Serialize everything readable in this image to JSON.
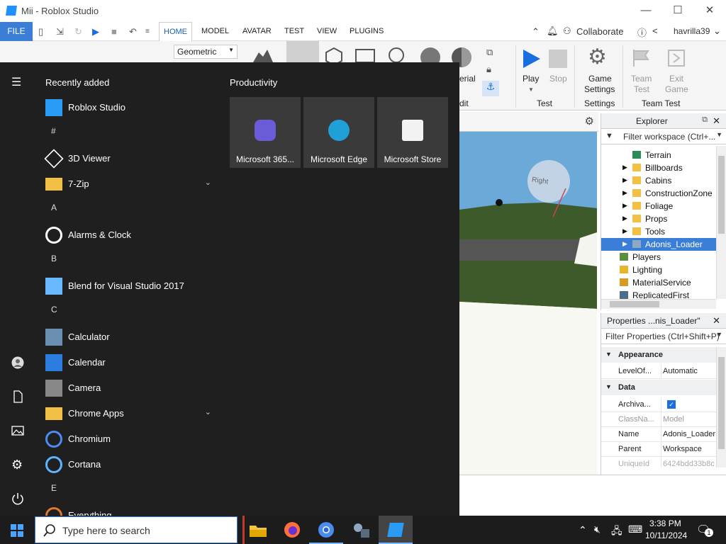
{
  "window": {
    "title": "Mii - Roblox Studio",
    "minimize": "—",
    "maximize": "☐",
    "close": "✕"
  },
  "menubar": {
    "file": "FILE",
    "tabs": [
      "HOME",
      "MODEL",
      "AVATAR",
      "TEST",
      "VIEW",
      "PLUGINS"
    ],
    "collaborate": "Collaborate",
    "username": "havrilla39"
  },
  "ribbon": {
    "dropdown_value": "Geometric",
    "partial_label_1": "erial",
    "partial_label_2": "dit",
    "play": "Play",
    "stop": "Stop",
    "test_group": "Test",
    "game_settings_1": "Game",
    "game_settings_2": "Settings",
    "settings_group": "Settings",
    "team_test_1": "Team",
    "team_test_2": "Test",
    "exit_game_1": "Exit",
    "exit_game_2": "Game",
    "team_test_group": "Team Test"
  },
  "explorer": {
    "title": "Explorer",
    "filter_placeholder": "Filter workspace (Ctrl+...",
    "items": [
      {
        "label": "Terrain",
        "icon": "terrain-icon",
        "indent": 2,
        "arrow": false
      },
      {
        "label": "Billboards",
        "icon": "folder-icon",
        "indent": 2,
        "arrow": true
      },
      {
        "label": "Cabins",
        "icon": "folder-icon",
        "indent": 2,
        "arrow": true
      },
      {
        "label": "ConstructionZone",
        "icon": "folder-icon",
        "indent": 2,
        "arrow": true
      },
      {
        "label": "Foliage",
        "icon": "folder-icon",
        "indent": 2,
        "arrow": true
      },
      {
        "label": "Props",
        "icon": "folder-icon",
        "indent": 2,
        "arrow": true
      },
      {
        "label": "Tools",
        "icon": "folder-icon",
        "indent": 2,
        "arrow": true
      },
      {
        "label": "Adonis_Loader",
        "icon": "model-icon",
        "indent": 2,
        "arrow": true,
        "selected": true
      },
      {
        "label": "Players",
        "icon": "players-icon",
        "indent": 1,
        "arrow": false
      },
      {
        "label": "Lighting",
        "icon": "lighting-icon",
        "indent": 1,
        "arrow": false
      },
      {
        "label": "MaterialService",
        "icon": "material-icon",
        "indent": 1,
        "arrow": false
      },
      {
        "label": "ReplicatedFirst",
        "icon": "replicated-icon",
        "indent": 1,
        "arrow": false
      }
    ]
  },
  "properties": {
    "title": "Properties ...nis_Loader\"",
    "filter_placeholder": "Filter Properties (Ctrl+Shift+P)",
    "section_appearance": "Appearance",
    "section_data": "Data",
    "rows": [
      {
        "key": "LevelOf...",
        "value": "Automatic"
      },
      {
        "key": "Archiva...",
        "value": "✓"
      },
      {
        "key": "ClassNa...",
        "value": "Model",
        "dim": true
      },
      {
        "key": "Name",
        "value": "Adonis_Loader"
      },
      {
        "key": "Parent",
        "value": "Workspace"
      },
      {
        "key": "UniqueId",
        "value": "6424bdd33b8c",
        "dim": true
      }
    ]
  },
  "viewport": {
    "sign_text": "Right"
  },
  "startmenu": {
    "recently_added": "Recently added",
    "productivity": "Productivity",
    "apps": [
      {
        "type": "app",
        "label": "Roblox Studio",
        "icon": "roblox-studio-icon"
      },
      {
        "type": "letter",
        "label": "#"
      },
      {
        "type": "app",
        "label": "3D Viewer",
        "icon": "3d-viewer-icon"
      },
      {
        "type": "folder",
        "label": "7-Zip",
        "icon": "folder-icon"
      },
      {
        "type": "letter",
        "label": "A"
      },
      {
        "type": "app",
        "label": "Alarms & Clock",
        "icon": "alarm-clock-icon"
      },
      {
        "type": "letter",
        "label": "B"
      },
      {
        "type": "app",
        "label": "Blend for Visual Studio 2017",
        "icon": "blend-icon"
      },
      {
        "type": "letter",
        "label": "C"
      },
      {
        "type": "app",
        "label": "Calculator",
        "icon": "calculator-icon"
      },
      {
        "type": "app",
        "label": "Calendar",
        "icon": "calendar-icon"
      },
      {
        "type": "app",
        "label": "Camera",
        "icon": "camera-icon"
      },
      {
        "type": "folder",
        "label": "Chrome Apps",
        "icon": "folder-icon"
      },
      {
        "type": "app",
        "label": "Chromium",
        "icon": "chromium-icon"
      },
      {
        "type": "app",
        "label": "Cortana",
        "icon": "cortana-icon"
      },
      {
        "type": "letter",
        "label": "E"
      },
      {
        "type": "app",
        "label": "Everything",
        "icon": "everything-icon"
      }
    ],
    "tiles": [
      {
        "label": "Microsoft 365...",
        "icon": "microsoft-365-icon"
      },
      {
        "label": "Microsoft Edge",
        "icon": "edge-icon"
      },
      {
        "label": "Microsoft Store",
        "icon": "store-icon"
      }
    ]
  },
  "taskbar": {
    "search_placeholder": "Type here to search",
    "time": "3:38 PM",
    "date": "10/11/2024",
    "notification_count": "1"
  }
}
